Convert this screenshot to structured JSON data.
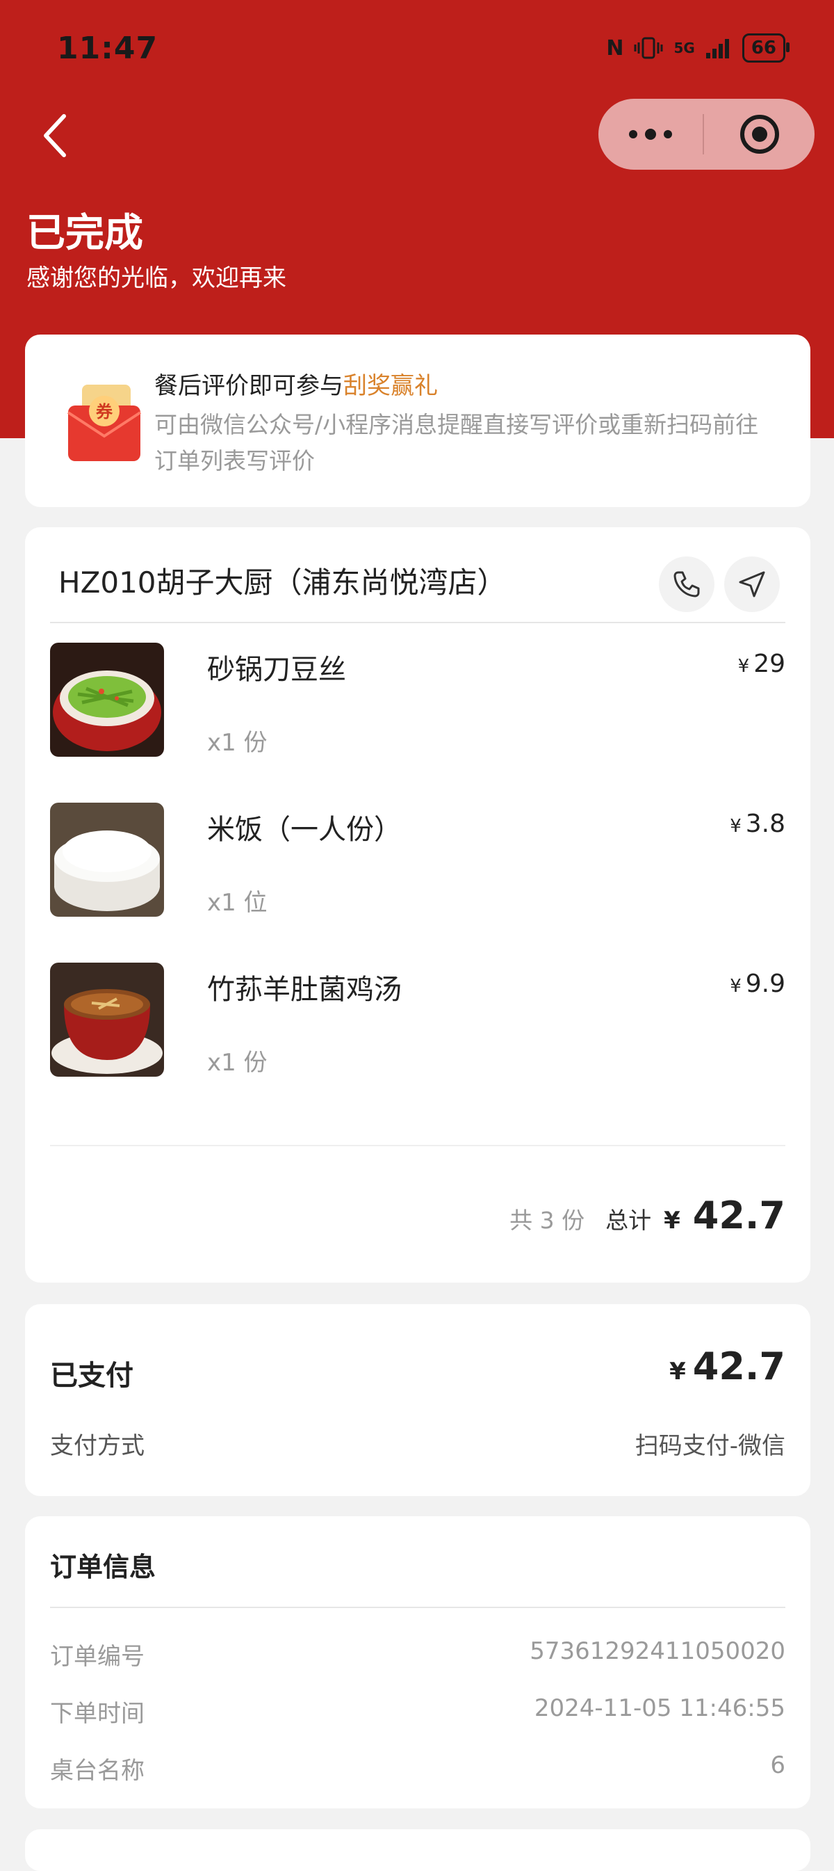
{
  "status_bar": {
    "time": "11:47",
    "nfc": "N",
    "signal": "5G",
    "battery": "66"
  },
  "header": {
    "title": "已完成",
    "subtitle": "感谢您的光临，欢迎再来"
  },
  "promo": {
    "title_prefix": "餐后评价即可参与",
    "title_highlight": "刮奖赢礼",
    "description": "可由微信公众号/小程序消息提醒直接写评价或重新扫码前往订单列表写评价",
    "icon_text": "券"
  },
  "store": {
    "name": "HZ010胡子大厨（浦东尚悦湾店）"
  },
  "items": [
    {
      "name": "砂锅刀豆丝",
      "qty": "x1 份",
      "currency": "¥",
      "price": "29"
    },
    {
      "name": "米饭（一人份）",
      "qty": "x1 位",
      "currency": "¥",
      "price": "3.8"
    },
    {
      "name": "竹荪羊肚菌鸡汤",
      "qty": "x1 份",
      "currency": "¥",
      "price": "9.9"
    }
  ],
  "summary": {
    "count": "共 3 份",
    "total_label": "总计",
    "currency": "¥",
    "total": "42.7"
  },
  "payment": {
    "title": "已支付",
    "currency": "¥",
    "amount": "42.7",
    "method_label": "支付方式",
    "method_value": "扫码支付-微信"
  },
  "order_info": {
    "title": "订单信息",
    "rows": [
      {
        "label": "订单编号",
        "value": "57361292411050020"
      },
      {
        "label": "下单时间",
        "value": "2024-11-05 11:46:55"
      },
      {
        "label": "桌台名称",
        "value": "6"
      }
    ]
  },
  "colors": {
    "brand_red": "#be1f1b",
    "highlight_orange": "#d9822b",
    "muted_text": "#9a9a9a"
  },
  "icons": [
    "back-chevron-icon",
    "more-dots-icon",
    "close-target-icon",
    "coupon-envelope-icon",
    "phone-icon",
    "navigate-arrow-icon"
  ]
}
